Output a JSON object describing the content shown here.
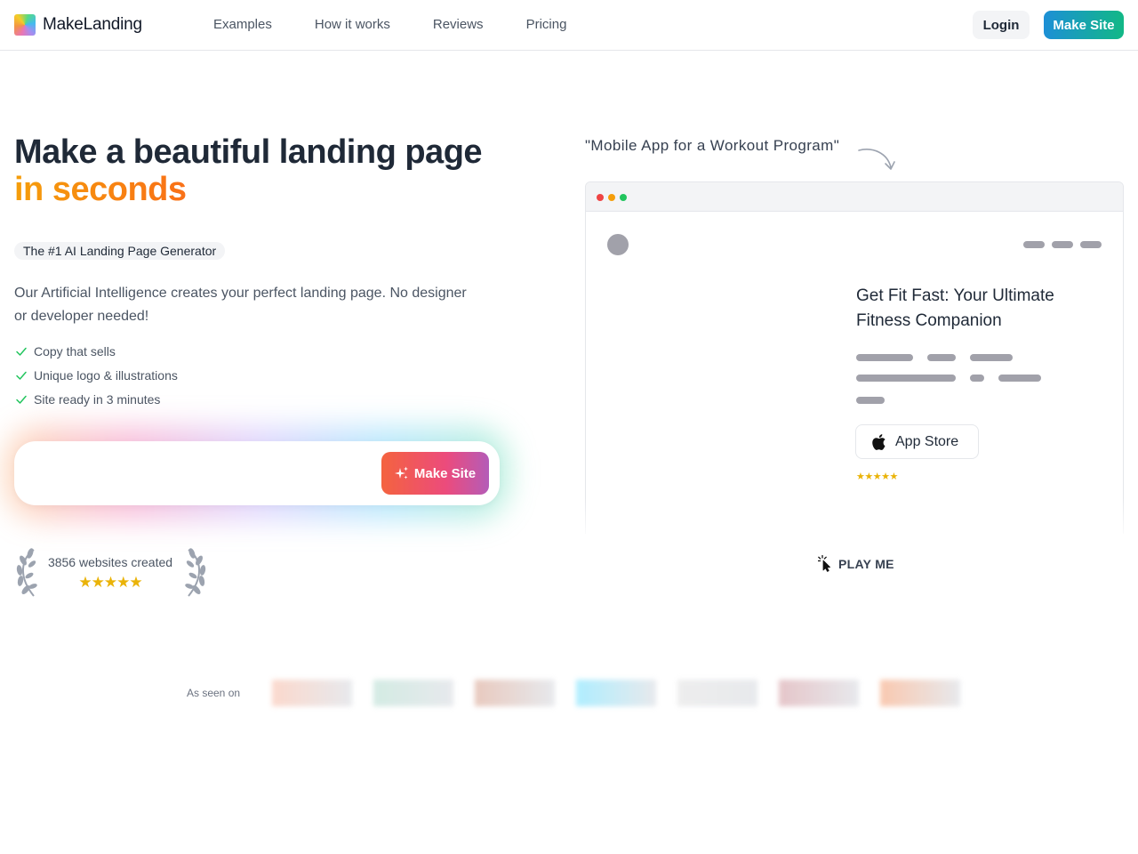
{
  "header": {
    "brand": "MakeLanding",
    "nav": [
      "Examples",
      "How it works",
      "Reviews",
      "Pricing"
    ],
    "login_label": "Login",
    "make_site_label": "Make Site"
  },
  "hero": {
    "title_line1": "Make a beautiful landing page",
    "title_line2": "in seconds",
    "tag": "The #1 AI Landing Page Generator",
    "description": "Our Artificial Intelligence creates your perfect landing page. No designer or developer needed!",
    "features": [
      "Copy that sells",
      "Unique logo & illustrations",
      "Site ready in 3 minutes"
    ],
    "input_value": "",
    "make_site_label": "Make Site"
  },
  "proof": {
    "count_text": "3856 websites created",
    "stars": "★★★★★"
  },
  "demo": {
    "prompt": "\"Mobile App for a Workout Program\"",
    "headline": "Get Fit Fast: Your Ultimate Fitness Companion",
    "app_store_label": "App Store",
    "stars": "★★★★★",
    "play_label": "PLAY ME"
  },
  "seen_on": {
    "label": "As seen on",
    "logo_colors": [
      "#fbd5c8",
      "#cfe9e1",
      "#e6c4b8",
      "#a7ecff",
      "#ececec",
      "#e3c0c4",
      "#f9c3a8"
    ]
  },
  "colors": {
    "accent_teal": "#12b886",
    "accent_blue": "#1d8fd6",
    "accent_pink": "#ec4b7c",
    "accent_orange": "#f4633f",
    "star": "#eab308",
    "check": "#22c55e"
  }
}
